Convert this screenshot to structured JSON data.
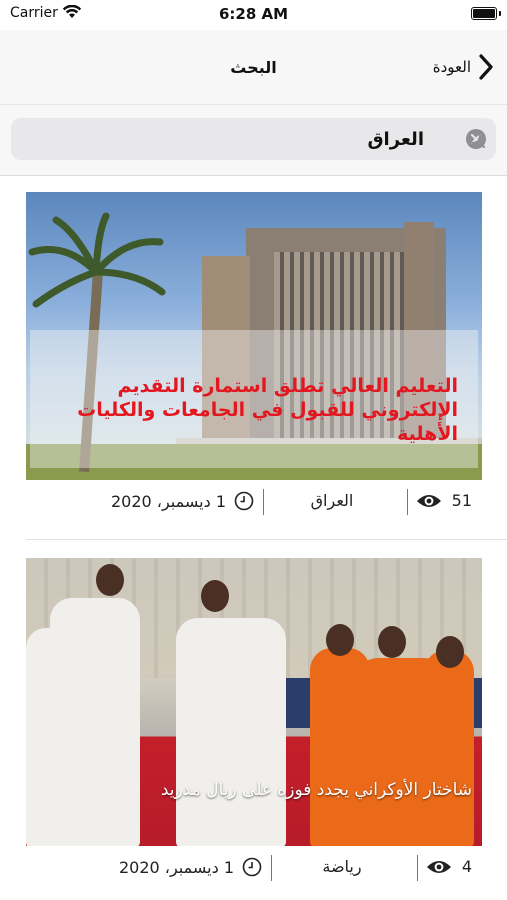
{
  "status_bar": {
    "carrier": "Carrier",
    "time": "6:28 AM"
  },
  "nav": {
    "title": "البحث",
    "back_label": "العودة"
  },
  "search": {
    "value": "العراق",
    "placeholder": ""
  },
  "colors": {
    "headline_red": "#e2171f",
    "nav_background": "#f7f7f7",
    "search_field": "#e8e8ea"
  },
  "articles": [
    {
      "headline": "التعليم العالي تطلق استمارة التقديم الإلكتروني للقبول في الجامعات والكليات الأهلية",
      "views": "51",
      "category": "العراق",
      "date": "1 ديسمبر، 2020"
    },
    {
      "headline": "شاختار الأوكراني يجدد فوزه على ريال مدريد",
      "views": "4",
      "category": "رياضة",
      "date": "1 ديسمبر، 2020"
    }
  ]
}
